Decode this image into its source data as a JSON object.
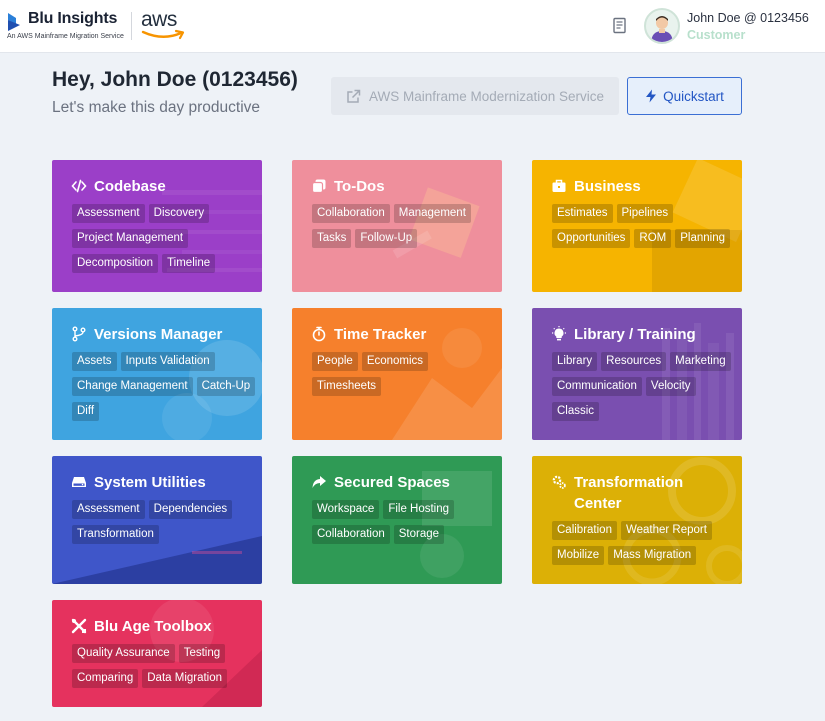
{
  "header": {
    "brand_name": "Blu Insights",
    "brand_subtitle": "An AWS Mainframe Migration Service",
    "partner_logo": "aws",
    "notes_icon": "document-icon",
    "user": {
      "name": "John Doe @ 0123456",
      "role": "Customer"
    }
  },
  "welcome": {
    "title": "Hey, John Doe (0123456)",
    "subtitle": "Let's make this day productive"
  },
  "actions": {
    "modernization_label": "AWS Mainframe Modernization Service",
    "quickstart_label": "Quickstart"
  },
  "colors": {
    "codebase": "#9b3fc8",
    "todos": "#ef8f9c",
    "business": "#f6b400",
    "versions": "#3fa4e0",
    "time": "#f6802c",
    "library": "#7a4fb0",
    "system": "#3f56c9",
    "secured": "#2f9a55",
    "transformation": "#dcb006",
    "toolbox": "#e5325e"
  },
  "modules": [
    {
      "title": "Codebase",
      "icon": "code-icon",
      "tags": [
        "Assessment",
        "Discovery",
        "Project Management",
        "Decomposition",
        "Timeline"
      ]
    },
    {
      "title": "To-Dos",
      "icon": "copy-icon",
      "tags": [
        "Collaboration",
        "Management",
        "Tasks",
        "Follow-Up"
      ]
    },
    {
      "title": "Business",
      "icon": "briefcase-icon",
      "tags": [
        "Estimates",
        "Pipelines",
        "Opportunities",
        "ROM",
        "Planning"
      ]
    },
    {
      "title": "Versions Manager",
      "icon": "branch-icon",
      "tags": [
        "Assets",
        "Inputs Validation",
        "Change Management",
        "Catch-Up",
        "Diff"
      ]
    },
    {
      "title": "Time Tracker",
      "icon": "stopwatch-icon",
      "tags": [
        "People",
        "Economics",
        "Timesheets"
      ]
    },
    {
      "title": "Library / Training",
      "icon": "lightbulb-icon",
      "tags": [
        "Library",
        "Resources",
        "Marketing",
        "Communication",
        "Velocity",
        "Classic"
      ]
    },
    {
      "title": "System Utilities",
      "icon": "hard-drive-icon",
      "tags": [
        "Assessment",
        "Dependencies",
        "Transformation"
      ]
    },
    {
      "title": "Secured Spaces",
      "icon": "share-arrow-icon",
      "tags": [
        "Workspace",
        "File Hosting",
        "Collaboration",
        "Storage"
      ]
    },
    {
      "title": "Transformation Center",
      "icon": "cogs-icon",
      "tags": [
        "Calibration",
        "Weather Report",
        "Mobilize",
        "Mass Migration"
      ]
    },
    {
      "title": "Blu Age Toolbox",
      "icon": "tools-icon",
      "tags": [
        "Quality Assurance",
        "Testing",
        "Comparing",
        "Data Migration"
      ]
    }
  ]
}
